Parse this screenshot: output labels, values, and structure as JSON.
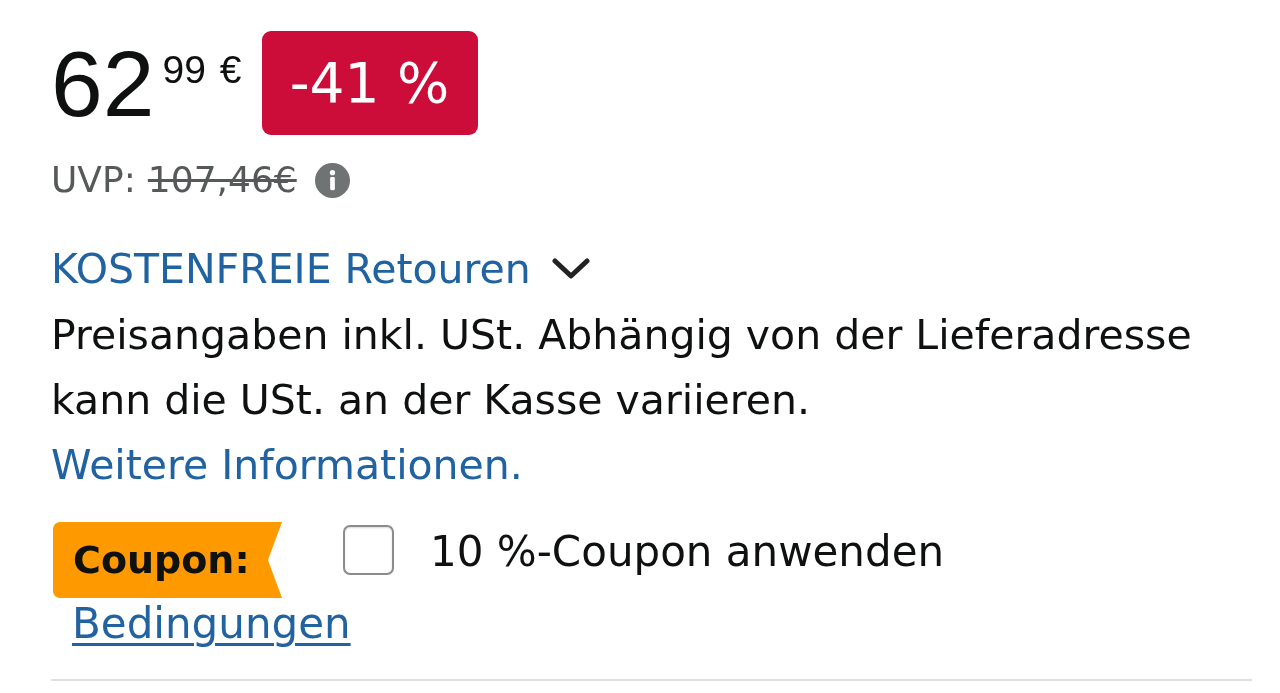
{
  "price": {
    "amount": "62",
    "cents": "99",
    "currency": "€",
    "discount": "-41 %"
  },
  "list_price": {
    "label": "UVP:",
    "value": "107,46€"
  },
  "returns": {
    "label": "KOSTENFREIE Retouren",
    "expanded": false
  },
  "tax_note": {
    "text": "Preisangaben inkl. USt. Abhängig von der Lieferadresse kann die USt. an der Kasse variieren.",
    "link": "Weitere Informationen."
  },
  "coupon": {
    "badge": "Coupon:",
    "checked": false,
    "label": "10 %-Coupon anwenden",
    "terms_link": "Bedingungen"
  }
}
